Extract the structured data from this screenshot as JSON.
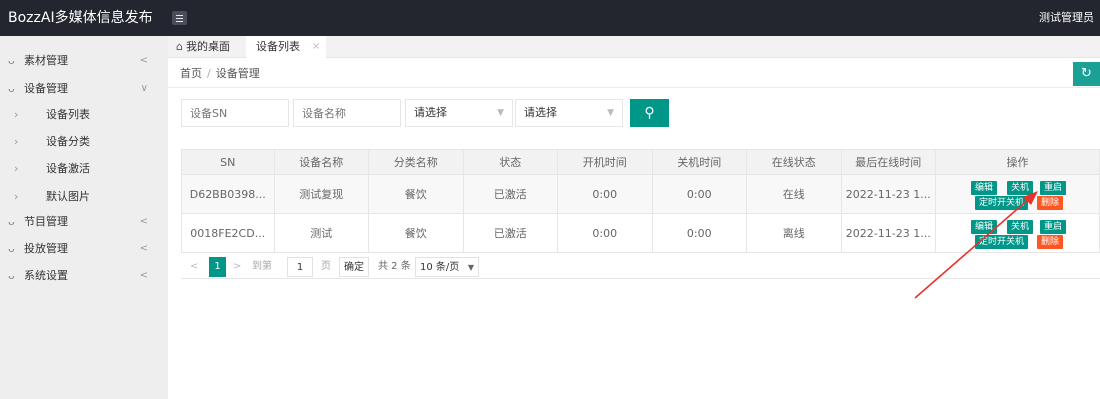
{
  "app": {
    "title": "BozzAI多媒体信息发布",
    "user": "测试管理员"
  },
  "sidebar": {
    "items": [
      {
        "label": "素材管理",
        "arrow": "<"
      },
      {
        "label": "设备管理",
        "arrow": "∨"
      },
      {
        "label": "设备列表"
      },
      {
        "label": "设备分类"
      },
      {
        "label": "设备激活"
      },
      {
        "label": "默认图片"
      },
      {
        "label": "节目管理",
        "arrow": "<"
      },
      {
        "label": "投放管理",
        "arrow": "<"
      },
      {
        "label": "系统设置",
        "arrow": "<"
      }
    ]
  },
  "tabs": {
    "home": "我的桌面",
    "active": "设备列表",
    "close": "×"
  },
  "breadcrumb": {
    "home": "首页",
    "separator": "/",
    "current": "设备管理"
  },
  "search": {
    "sn_placeholder": "设备SN",
    "name_placeholder": "设备名称",
    "select1": "请选择",
    "select2": "请选择"
  },
  "table": {
    "headers": [
      "SN",
      "设备名称",
      "分类名称",
      "状态",
      "开机时间",
      "关机时间",
      "在线状态",
      "最后在线时间",
      "操作"
    ],
    "rows": [
      {
        "sn": "D62BB0398...",
        "name": "测试复现",
        "category": "餐饮",
        "status": "已激活",
        "on": "0:00",
        "off": "0:00",
        "online": "在线",
        "last": "2022-11-23 1..."
      },
      {
        "sn": "0018FE2CD...",
        "name": "测试",
        "category": "餐饮",
        "status": "已激活",
        "on": "0:00",
        "off": "0:00",
        "online": "离线",
        "last": "2022-11-23 1..."
      }
    ],
    "ops": {
      "edit": "编辑",
      "shutdown": "关机",
      "restart": "重启",
      "timer": "定时开关机",
      "delete": "删除"
    }
  },
  "pager": {
    "prev": "<",
    "current": "1",
    "next": ">",
    "goto": "到第",
    "page_input": "1",
    "page_unit": "页",
    "confirm": "确定",
    "total": "共 2 条",
    "page_size": "10 条/页"
  },
  "colors": {
    "header": "#23262e",
    "accent": "#009688",
    "danger": "#ff5722",
    "annotation": "#e8322b"
  }
}
